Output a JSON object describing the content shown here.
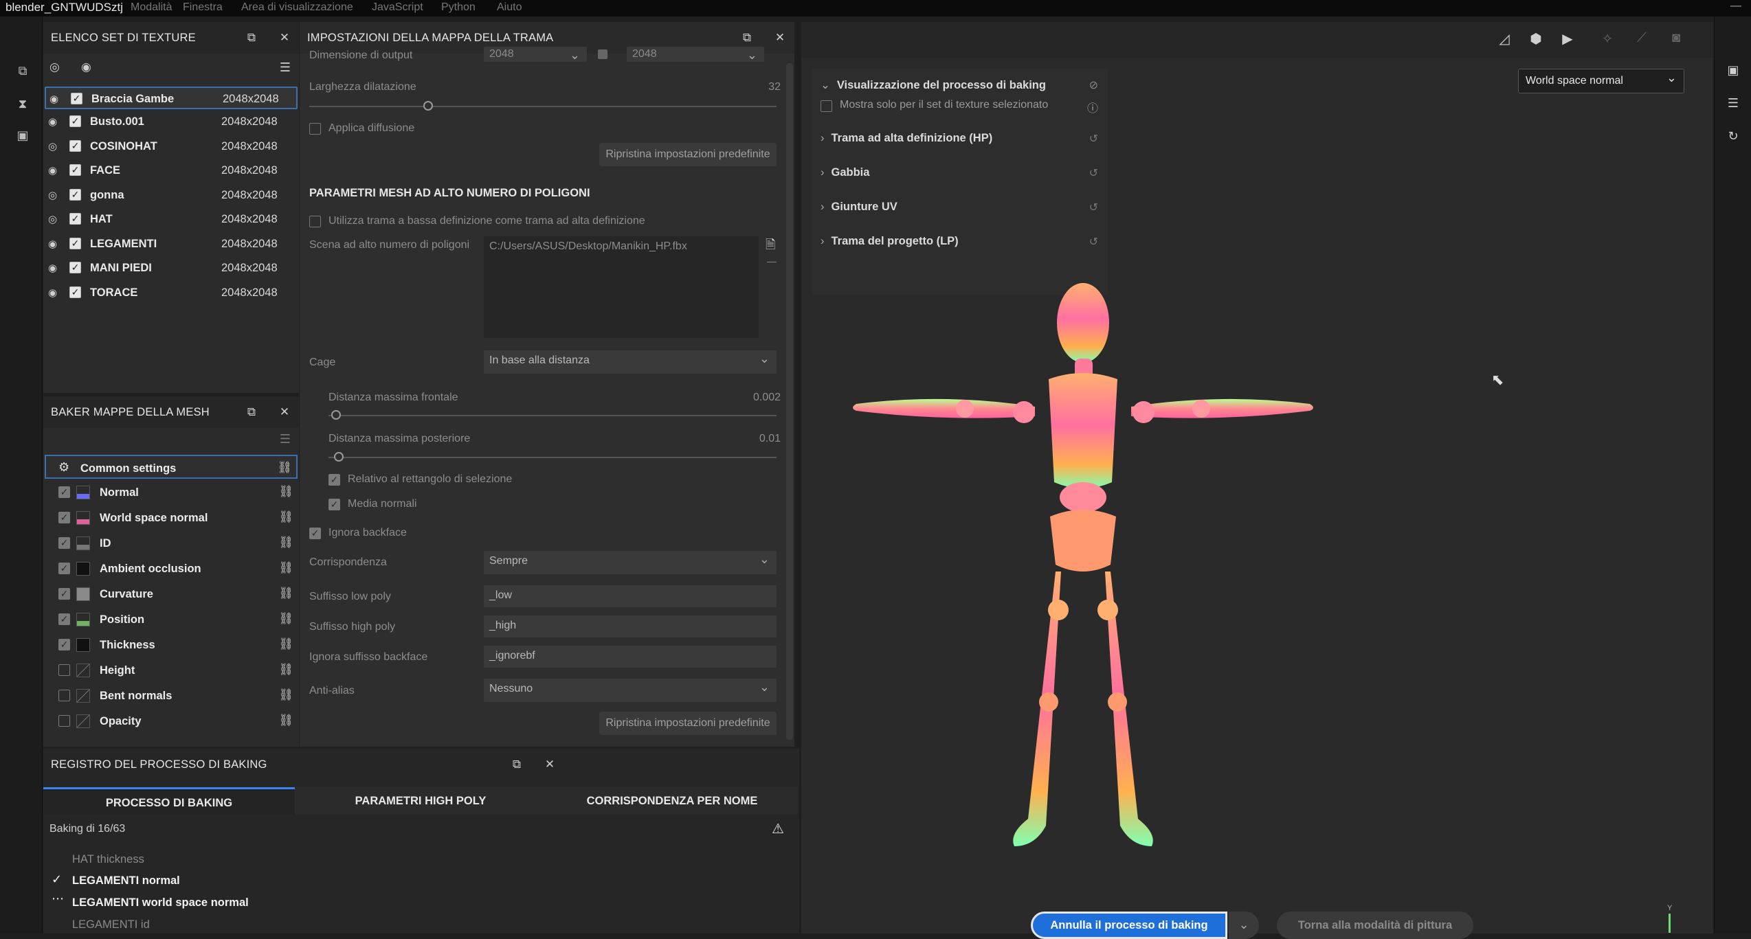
{
  "window": {
    "title": "blender_GNTWUDSztj",
    "menus": [
      "Modalità",
      "Finestra",
      "Area di visualizzazione",
      "JavaScript",
      "Python",
      "Aiuto"
    ]
  },
  "texture_sets": {
    "title": "ELENCO SET DI TEXTURE",
    "items": [
      {
        "name": "Braccia Gambe",
        "res": "2048x2048"
      },
      {
        "name": "Busto.001",
        "res": "2048x2048"
      },
      {
        "name": "COSINOHAT",
        "res": "2048x2048"
      },
      {
        "name": "FACE",
        "res": "2048x2048"
      },
      {
        "name": "gonna",
        "res": "2048x2048"
      },
      {
        "name": "HAT",
        "res": "2048x2048"
      },
      {
        "name": "LEGAMENTI",
        "res": "2048x2048"
      },
      {
        "name": "MANI PIEDI",
        "res": "2048x2048"
      },
      {
        "name": "TORACE",
        "res": "2048x2048"
      }
    ]
  },
  "baker": {
    "title": "BAKER MAPPE DELLA MESH",
    "common": "Common settings",
    "items": [
      {
        "label": "Normal",
        "checked": true,
        "color": "#6c6cf0"
      },
      {
        "label": "World space normal",
        "checked": true,
        "color": "#e0609a"
      },
      {
        "label": "ID",
        "checked": true,
        "color": "#777777"
      },
      {
        "label": "Ambient occlusion",
        "checked": true,
        "color": "#202020"
      },
      {
        "label": "Curvature",
        "checked": true,
        "color": "#8a8a8a"
      },
      {
        "label": "Position",
        "checked": true,
        "color": "#70b060"
      },
      {
        "label": "Thickness",
        "checked": true,
        "color": "#202020"
      },
      {
        "label": "Height",
        "checked": false,
        "color": "#2b2b2b"
      },
      {
        "label": "Bent normals",
        "checked": false,
        "color": "#2b2b2b"
      },
      {
        "label": "Opacity",
        "checked": false,
        "color": "#2b2b2b"
      }
    ]
  },
  "settings": {
    "title": "IMPOSTAZIONI DELLA MAPPA DELLA TRAMA",
    "output_label": "Dimensione di output",
    "output_w": "2048",
    "output_h": "2048",
    "dilation_label": "Larghezza dilatazione",
    "dilation_value": "32",
    "apply_diffusion": "Applica diffusione",
    "reset": "Ripristina impostazioni predefinite",
    "hp_section": "PARAMETRI MESH AD ALTO NUMERO DI POLIGONI",
    "use_lp_as_hp": "Utilizza trama a bassa definizione come trama ad alta definizione",
    "hp_scene_label": "Scena ad alto numero di poligoni",
    "hp_scene_value": "C:/Users/ASUS/Desktop/Manikin_HP.fbx",
    "cage_label": "Cage",
    "cage_value": "In base alla distanza",
    "front_label": "Distanza massima frontale",
    "front_value": "0.002",
    "back_label": "Distanza massima posteriore",
    "back_value": "0.01",
    "relative_bbox": "Relativo al rettangolo di selezione",
    "average_normals": "Media normali",
    "ignore_backface": "Ignora backface",
    "match_label": "Corrispondenza",
    "match_value": "Sempre",
    "lp_suffix_label": "Suffisso low poly",
    "lp_suffix_value": "_low",
    "hp_suffix_label": "Suffisso high poly",
    "hp_suffix_value": "_high",
    "ignore_suffix_label": "Ignora suffisso backface",
    "ignore_suffix_value": "_ignorebf",
    "aa_label": "Anti-alias",
    "aa_value": "Nessuno"
  },
  "log": {
    "title": "REGISTRO DEL PROCESSO DI BAKING",
    "tabs": [
      "PROCESSO DI BAKING",
      "PARAMETRI HIGH POLY",
      "CORRISPONDENZA PER NOME"
    ],
    "status": "Baking di 16/63",
    "lines": [
      {
        "text": "HAT thickness",
        "state": "pending"
      },
      {
        "text": "LEGAMENTI normal",
        "state": "done"
      },
      {
        "text": "LEGAMENTI world space normal",
        "state": "running"
      },
      {
        "text": "LEGAMENTI id",
        "state": "pending"
      }
    ]
  },
  "viewport": {
    "map_select": "World space normal",
    "bake_vis": {
      "title": "Visualizzazione del processo di baking",
      "only_selected": "Mostra solo per il set di texture selezionato",
      "rows": [
        "Trama ad alta definizione (HP)",
        "Gabbia",
        "Giunture UV",
        "Trama del progetto (LP)"
      ]
    },
    "cancel_button": "Annulla il processo di baking",
    "paint_button": "Torna alla modalità di pittura",
    "axis_label": "Y"
  }
}
